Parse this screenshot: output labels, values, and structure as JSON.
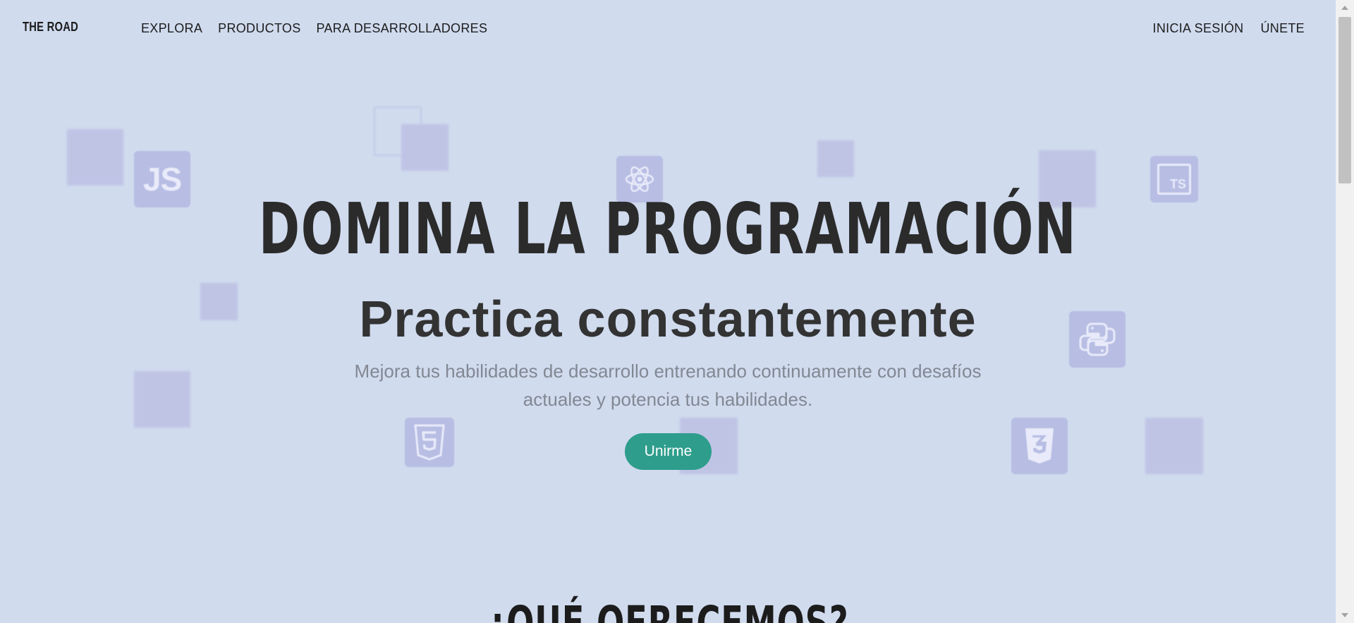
{
  "nav": {
    "logo": "THE ROAD",
    "left_links": [
      "EXPLORA",
      "PRODUCTOS",
      "PARA DESARROLLADORES"
    ],
    "right_links": [
      "INICIA SESIÓN",
      "ÚNETE"
    ]
  },
  "hero": {
    "title": "DOMINA LA PROGRAMACIÓN",
    "subtitle": "Practica constantemente",
    "description": "Mejora tus habilidades de desarrollo entrenando continuamente con desafíos actuales y potencia tus habilidades.",
    "cta_label": "Unirme"
  },
  "section": {
    "title": "¿QUÉ OFRECEMOS?"
  },
  "tiles": {
    "js_label": "JS",
    "ts_label": "TS"
  },
  "colors": {
    "background": "#d0dbee",
    "accent": "#2e9d8c",
    "tile": "#b7bde3"
  },
  "icons": [
    "javascript-icon",
    "react-icon",
    "typescript-icon",
    "python-icon",
    "html5-icon",
    "css3-icon"
  ]
}
